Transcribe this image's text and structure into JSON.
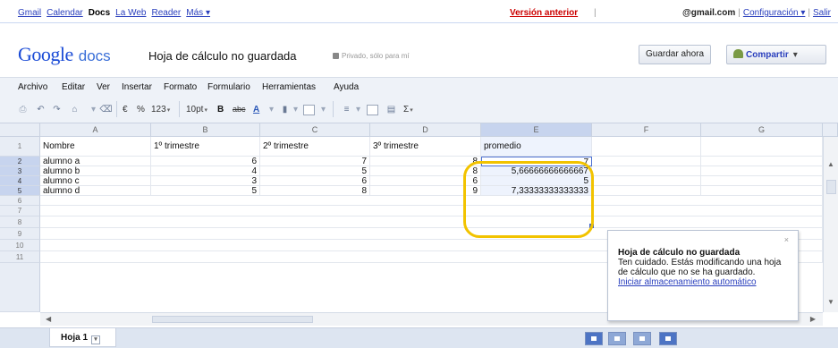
{
  "gbar": {
    "links": [
      "Gmail",
      "Calendar",
      "Docs",
      "La Web",
      "Reader",
      "Más ▾"
    ],
    "active_link": "Docs",
    "previous_version": "Versión anterior",
    "separator": "|",
    "account": "@gmail.com",
    "settings": "Configuración ▾",
    "signout": "Salir"
  },
  "header": {
    "logo_text": "Google",
    "logo_product": "docs",
    "doc_title": "Hoja de cálculo no guardada",
    "privacy": "Privado, sólo para mí",
    "save_now": "Guardar ahora",
    "share": "Compartir",
    "share_caret": "▾"
  },
  "menu": [
    "Archivo",
    "Editar",
    "Ver",
    "Insertar",
    "Formato",
    "Formulario",
    "Herramientas",
    "Ayuda"
  ],
  "toolbar": {
    "currency": "€",
    "percent": "%",
    "number_format": "123",
    "font_size": "10pt",
    "bold": "B",
    "strike": "abc",
    "text_color": "A",
    "sum": "Σ",
    "dropdown": "▾"
  },
  "grid": {
    "columns": [
      "A",
      "B",
      "C",
      "D",
      "E",
      "F",
      "G"
    ],
    "selected_column": "E",
    "rows": [
      "1",
      "2",
      "3",
      "4",
      "5",
      "6",
      "7",
      "8",
      "9",
      "10",
      "11"
    ],
    "selected_rows": [
      "2",
      "3",
      "4",
      "5"
    ],
    "headers": [
      "Nombre",
      "1º trimestre",
      "2º trimestre",
      "3º trimestre",
      "promedio"
    ],
    "data": [
      {
        "name": "alumno a",
        "t1": "6",
        "t2": "7",
        "t3": "8",
        "avg": "7"
      },
      {
        "name": "alumno b",
        "t1": "4",
        "t2": "5",
        "t3": "8",
        "avg": "5,66666666666667"
      },
      {
        "name": "alumno c",
        "t1": "3",
        "t2": "6",
        "t3": "6",
        "avg": "5"
      },
      {
        "name": "alumno d",
        "t1": "5",
        "t2": "8",
        "t3": "9",
        "avg": "7,33333333333333"
      }
    ],
    "highlight_color": "#f2c300"
  },
  "notification": {
    "close": "×",
    "title": "Hoja de cálculo no guardada",
    "body": "Ten cuidado. Estás modificando una hoja de cálculo que no se ha guardado.",
    "link": "Iniciar almacenamiento automático"
  },
  "sheets": {
    "tab": "Hoja 1",
    "tab_menu": "▾"
  }
}
